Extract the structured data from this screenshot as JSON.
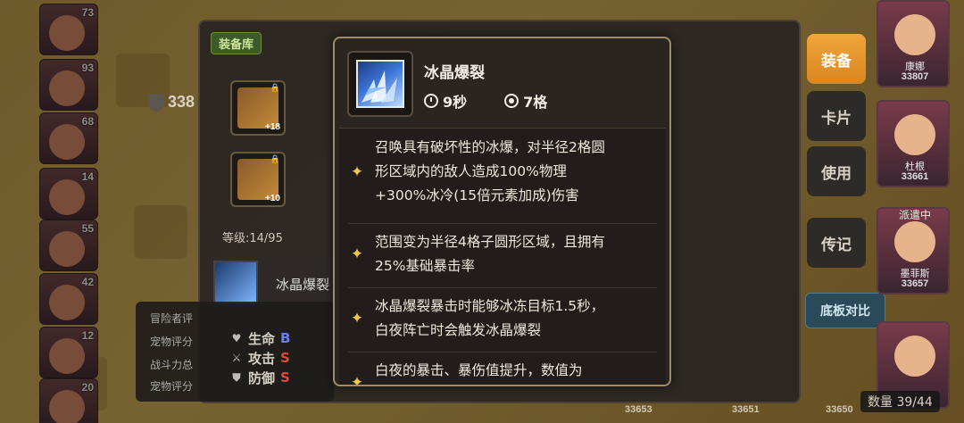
{
  "colors": {
    "tooltip_border": "#a08a6a",
    "star": "#f2c84a",
    "active_tab": "#f0a63a",
    "grade_blue": "#6b7bff",
    "grade_red": "#e0483a"
  },
  "roster": {
    "levels": [
      "73",
      "93",
      "68",
      "14",
      "55",
      "42",
      "12",
      "20"
    ]
  },
  "panel": {
    "library_tag": "装备库",
    "power": "338",
    "slot1_plus": "+18",
    "slot2_plus": "+10",
    "level_text": "等级:14/95",
    "skill_name": "冰晶爆裂",
    "stats": [
      {
        "icon": "heart-icon",
        "label": "生命",
        "grade": "B"
      },
      {
        "icon": "sword-icon",
        "label": "攻击",
        "grade": "S"
      },
      {
        "icon": "shield-icon",
        "label": "防御",
        "grade": "S"
      }
    ]
  },
  "side": {
    "equip_label": "装备",
    "card_label": "卡片",
    "use_label": "使用",
    "story_label": "传记",
    "compare_label": "底板对比",
    "count_text": "数量 39/44"
  },
  "heroes": [
    {
      "name": "康娜",
      "power": "33807",
      "dispatch": ""
    },
    {
      "name": "杜根",
      "power": "33661",
      "dispatch": ""
    },
    {
      "name": "墨菲斯",
      "power": "33657",
      "dispatch": "派遣中"
    },
    {
      "name": "",
      "power": "",
      "dispatch": ""
    }
  ],
  "bottom_numbers": [
    "33653",
    "33651",
    "33650"
  ],
  "tooltip": {
    "title": "冰晶爆裂",
    "cooldown": "9秒",
    "range": "7格",
    "entries": [
      {
        "lines": [
          "召唤具有破坏性的冰爆，对半径2格圆",
          "形区域内的敌人造成100%物理",
          "+300%冰冷(15倍元素加成)伤害"
        ]
      },
      {
        "lines": [
          "范围变为半径4格子圆形区域，且拥有",
          "25%基础暴击率"
        ]
      },
      {
        "lines": [
          "冰晶爆裂暴击时能够冰冻目标1.5秒，",
          "白夜阵亡时会触发冰晶爆裂"
        ]
      },
      {
        "lines": [
          "白夜的暴击、暴伤值提升，数值为"
        ]
      }
    ]
  }
}
